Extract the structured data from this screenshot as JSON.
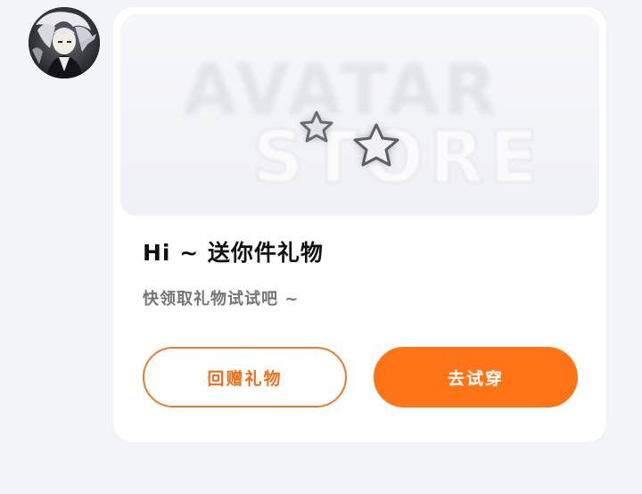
{
  "avatar": {
    "icon": "user-avatar-anime-character"
  },
  "banner": {
    "line1": "AVATAR",
    "line2": "STORE",
    "icons": [
      "star-icon",
      "star-icon"
    ]
  },
  "card": {
    "title": "Hi ~ 送你件礼物",
    "subtitle": "快领取礼物试试吧 ~"
  },
  "actions": {
    "gift_back_label": "回赠礼物",
    "try_on_label": "去试穿"
  },
  "colors": {
    "accent": "#ff7417",
    "background": "#f3f4f9",
    "card": "#ffffff",
    "subtitle_text": "#757575"
  }
}
